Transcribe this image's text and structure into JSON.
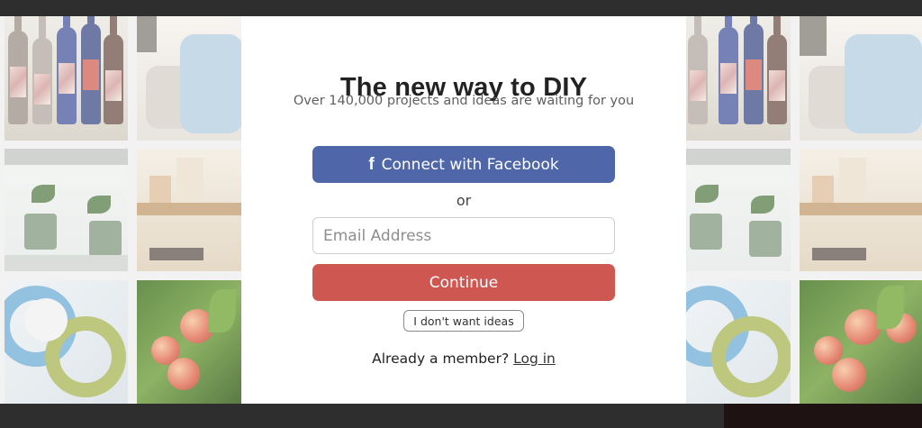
{
  "modal": {
    "title": "The new way to DIY",
    "subtitle": "Over 140,000 projects and ideas are waiting for you",
    "facebook_button": {
      "icon": "facebook-icon",
      "label": "Connect with Facebook"
    },
    "or_text": "or",
    "email_input": {
      "placeholder": "Email Address",
      "value": ""
    },
    "continue_button": "Continue",
    "no_ideas_button": "I don't want ideas",
    "member_text": "Already a member?",
    "login_link": "Log in"
  },
  "colors": {
    "facebook_blue": "#4f67a8",
    "continue_red": "#cf5752",
    "title_text": "#222222",
    "backdrop_dark": "#2e2e2e"
  }
}
